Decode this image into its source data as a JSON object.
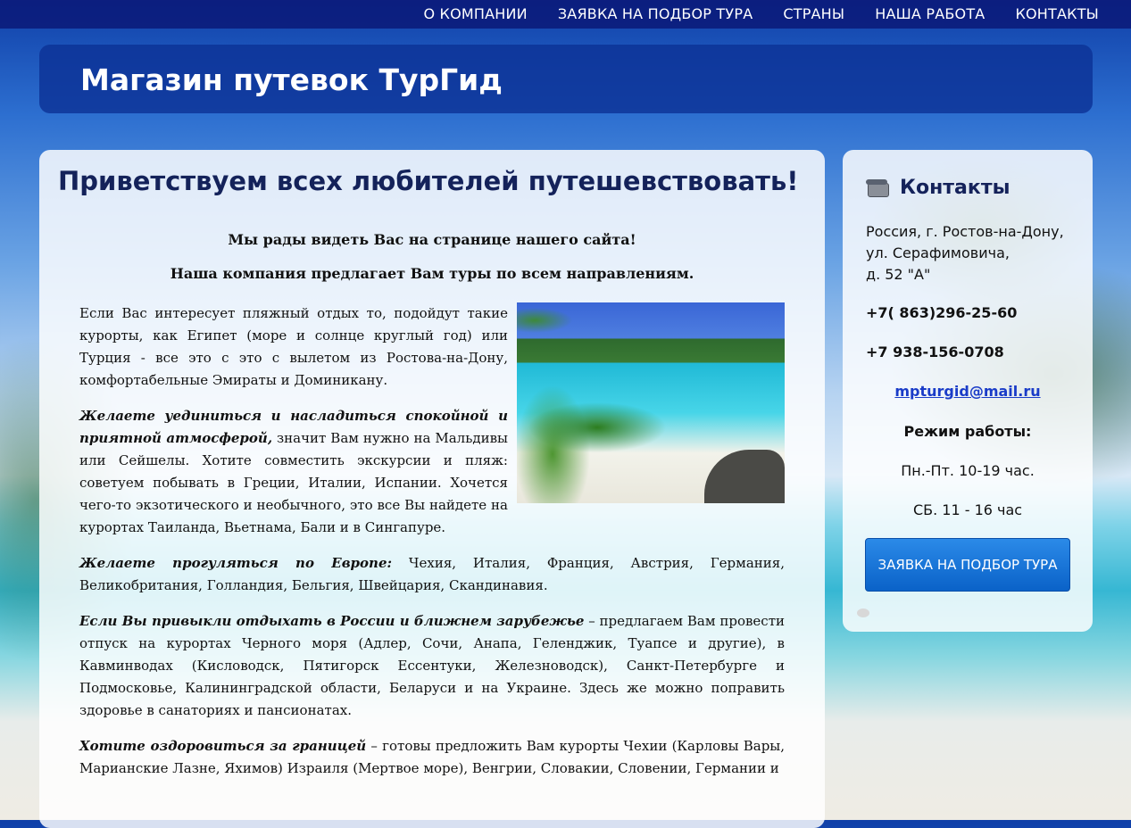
{
  "nav": {
    "items": [
      {
        "label": "О КОМПАНИИ"
      },
      {
        "label": "ЗАЯВКА НА ПОДБОР ТУРА"
      },
      {
        "label": "СТРАНЫ"
      },
      {
        "label": "НАША РАБОТА"
      },
      {
        "label": "КОНТАКТЫ"
      }
    ]
  },
  "header": {
    "title": "Магазин путевок ТурГид"
  },
  "main": {
    "title": "Приветствуем всех любителей путешевствовать!",
    "intro1": "Мы рады видеть Вас на странице нашего сайта!",
    "intro2": "Наша компания предлагает Вам  туры по всем направлениям.",
    "p1": "Если Вас интересует пляжный отдых то, подойдут такие курорты, как Египет (море и солнце круглый год) или Турция - все это с это с вылетом из Ростова-на-Дону, комфортабельные Эмираты и Доминикану.",
    "p2_em": "Желаете уединиться и насладиться спокойной и приятной атмосферой,",
    "p2": " значит Вам нужно на  Мальдивы или Сейшелы. Хотите совместить экскурсии и пляж: советуем побывать в Греции, Италии, Испании. Хочется чего-то экзотического и необычного, это все Вы найдете на курортах Таиланда, Вьетнама, Бали и в Сингапуре.",
    "p3_em": "Желаете прогуляться по Европе:",
    "p3": " Чехия, Италия, Франция, Австрия, Германия, Великобритания, Голландия, Бельгия, Швейцария, Скандинавия.",
    "p4_em": "Если Вы привыкли отдыхать в России и ближнем зарубежье",
    "p4": " – предлагаем Вам провести отпуск на курортах Черного моря (Адлер, Сочи, Анапа, Геленджик, Туапсе и другие), в Кавминводах (Кисловодск, Пятигорск Ессентуки, Железноводск), Санкт-Петербурге и Подмосковье, Калининградской области, Беларуси и на Украине. Здесь же можно поправить здоровье в санаториях и пансионатах.",
    "p5_em": "Хотите оздоровиться за границей",
    "p5": " – готовы предложить Вам курорты Чехии (Карловы Вары, Марианские Лазне, Яхимов) Израиля (Мертвое море), Венгрии, Словакии, Словении, Германии и"
  },
  "sidebar": {
    "title": "Контакты",
    "address_line1": "Россия, г. Ростов-на-Дону,",
    "address_line2": "ул. Серафимовича,",
    "address_line3": "д. 52 \"А\"",
    "phone1": "+7( 863)296-25-60",
    "phone2": "+7 938-156-0708",
    "email": "mpturgid@mail.ru",
    "hours_title": "Режим работы:",
    "hours_weekdays": "Пн.-Пт. 10-19 час.",
    "hours_saturday": "СБ. 11 - 16 час",
    "cta_label": "ЗАЯВКА НА ПОДБОР ТУРА"
  }
}
